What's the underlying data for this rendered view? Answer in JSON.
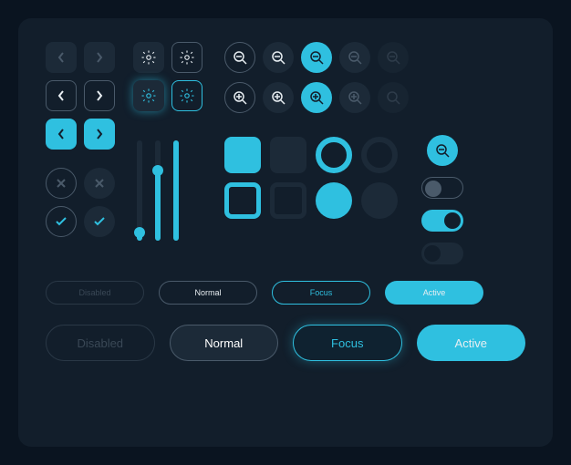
{
  "colors": {
    "background": "#0a1420",
    "panel": "#121e2b",
    "surface": "#1c2a38",
    "stroke": "#4a5a6a",
    "accent": "#2fc0e0",
    "text": "#e8eef2",
    "disabled": "#3a4856"
  },
  "navButtons": {
    "left": "chevron-left",
    "right": "chevron-right"
  },
  "settingsButtons": {
    "icon": "gear"
  },
  "zoomButtons": {
    "zoomOut": "zoom-out",
    "zoomIn": "zoom-in",
    "search": "search"
  },
  "statusButtons": {
    "close": "close",
    "check": "check"
  },
  "sliders": [
    {
      "value": 8
    },
    {
      "value": 70
    },
    {
      "value": 100
    }
  ],
  "toggles": [
    {
      "state": "off",
      "style": "stroke"
    },
    {
      "state": "on",
      "style": "fill"
    },
    {
      "state": "off",
      "style": "fill"
    }
  ],
  "buttonStates": {
    "small": [
      {
        "label": "Disabled",
        "state": "disabled"
      },
      {
        "label": "Normal",
        "state": "normal"
      },
      {
        "label": "Focus",
        "state": "focus"
      },
      {
        "label": "Active",
        "state": "active"
      }
    ],
    "large": [
      {
        "label": "Disabled",
        "state": "disabled"
      },
      {
        "label": "Normal",
        "state": "normal"
      },
      {
        "label": "Focus",
        "state": "focus"
      },
      {
        "label": "Active",
        "state": "active"
      }
    ]
  }
}
